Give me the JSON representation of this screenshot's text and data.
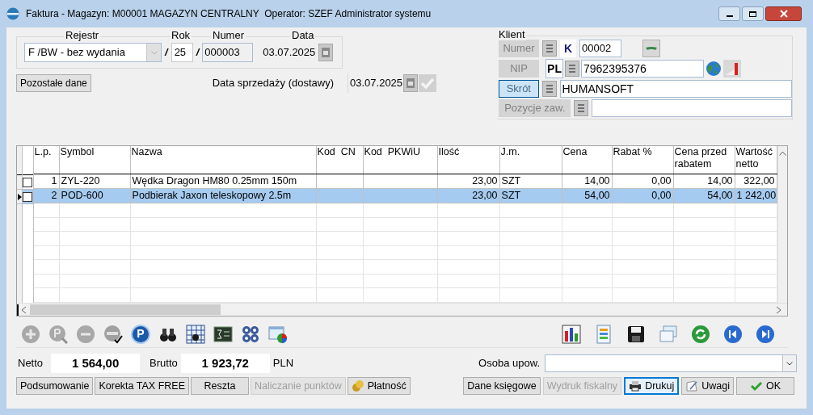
{
  "window": {
    "title": "Faktura - Magazyn: M00001 MAGAZYN CENTRALNY  Operator: SZEF Administrator systemu"
  },
  "header": {
    "rejestr_label": "Rejestr",
    "rejestr_value": "F /BW - bez wydania",
    "rok_label": "Rok",
    "rok_value": "25",
    "separator": "/",
    "numer_label": "Numer",
    "numer_value": "000003",
    "data_label": "Data",
    "data_value": "03.07.2025",
    "other_button": "Pozostałe dane",
    "sale_date_label": "Data sprzedaży (dostawy)",
    "sale_date_value": "03.07.2025"
  },
  "client": {
    "title": "Klient",
    "fields": [
      {
        "label": "Numer",
        "focused": false,
        "prefix": "K",
        "value": "00002",
        "kind": "numer"
      },
      {
        "label": "NIP",
        "focused": false,
        "prefix": "PL",
        "value": "7962395376",
        "kind": "nip"
      },
      {
        "label": "Skrót",
        "focused": true,
        "value": "HUMANSOFT",
        "kind": "wide"
      },
      {
        "label": "Pozycje zaw.",
        "focused": false,
        "kind": "wide"
      }
    ]
  },
  "table": {
    "columns": [
      "L.p.",
      "Symbol",
      "Nazwa",
      "Kod  CN",
      "Kod  PKWiU",
      "Ilość",
      "J.m.",
      "Cena",
      "Rabat %",
      "Cena przed rabatem",
      "Wartość netto"
    ],
    "rows": [
      {
        "checked": false,
        "selected": false,
        "lp": "1",
        "symbol": "ZYL-220",
        "name": "Wędka Dragon HM80 0.25mm 150m",
        "qty": "23,00",
        "unit": "SZT",
        "price": "14,00",
        "discount": "0,00",
        "price_before": "14,00",
        "value": "322,00"
      },
      {
        "checked": false,
        "selected": true,
        "lp": "2",
        "symbol": "POD-600",
        "name": "Podbierak Jaxon teleskopowy 2.5m",
        "qty": "23,00",
        "unit": "SZT",
        "price": "54,00",
        "discount": "0,00",
        "price_before": "54,00",
        "value": "1 242,00"
      }
    ]
  },
  "toolbar": {
    "p_label": "P"
  },
  "totals": {
    "netto_label": "Netto",
    "netto": "1 564,00",
    "brutto_label": "Brutto",
    "brutto": "1 923,72",
    "currency": "PLN"
  },
  "osoba": {
    "label": "Osoba upow."
  },
  "left_buttons": [
    {
      "label": "Podsumowanie",
      "disabled": false
    },
    {
      "label": "Korekta TAX FREE",
      "disabled": false
    },
    {
      "label": "Reszta",
      "disabled": false
    },
    {
      "label": "Naliczanie punktów",
      "disabled": true
    },
    {
      "label": "Płatność",
      "disabled": false,
      "kind": "coins"
    }
  ],
  "right_buttons": [
    {
      "label": "Dane księgowe",
      "disabled": false,
      "default": false
    },
    {
      "label": "Wydruk fiskalny",
      "disabled": true,
      "default": false
    },
    {
      "label": "Drukuj",
      "disabled": false,
      "default": true,
      "kind": "printer"
    },
    {
      "label": "Uwagi",
      "disabled": false,
      "default": false,
      "kind": "note"
    },
    {
      "label": "OK",
      "disabled": false,
      "default": false,
      "kind": "check"
    }
  ]
}
